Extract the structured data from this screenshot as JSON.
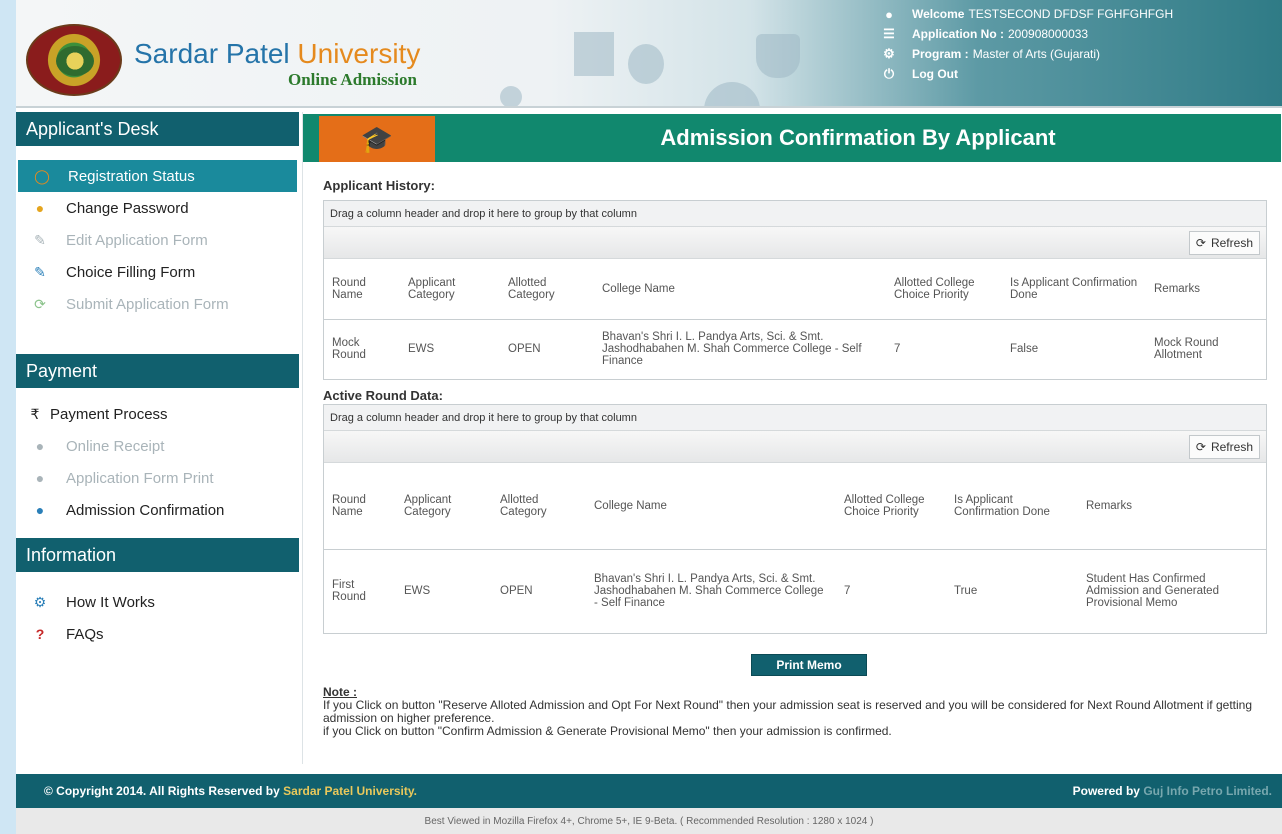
{
  "header": {
    "university_name": "Sardar Patel",
    "university_name_accent": "University",
    "subtitle": "Online Admission",
    "welcome_label": "Welcome",
    "welcome_value": "TESTSECOND DFDSF FGHFGHFGH",
    "application_label": "Application No :",
    "application_value": "200908000033",
    "program_label": "Program :",
    "program_value": "Master of Arts (Gujarati)",
    "logout_label": "Log Out"
  },
  "sidebar": {
    "applicant_desk_title": "Applicant's Desk",
    "applicant_items": [
      {
        "label": "Registration Status",
        "icon": "status-icon",
        "state": "active"
      },
      {
        "label": "Change Password",
        "icon": "key-icon",
        "state": "enabled"
      },
      {
        "label": "Edit Application Form",
        "icon": "edit-icon",
        "state": "disabled"
      },
      {
        "label": "Choice Filling Form",
        "icon": "edit-icon",
        "state": "enabled"
      },
      {
        "label": "Submit Application Form",
        "icon": "submit-icon",
        "state": "disabled"
      }
    ],
    "payment_title": "Payment",
    "payment_items": [
      {
        "label": "Payment Process",
        "icon": "rupee-icon",
        "state": "enabled"
      },
      {
        "label": "Online Receipt",
        "icon": "globe-icon",
        "state": "disabled"
      },
      {
        "label": "Application Form Print",
        "icon": "globe-icon",
        "state": "disabled"
      },
      {
        "label": "Admission Confirmation",
        "icon": "globe-icon",
        "state": "enabled"
      }
    ],
    "information_title": "Information",
    "information_items": [
      {
        "label": "How It Works",
        "icon": "gears-icon"
      },
      {
        "label": "FAQs",
        "icon": "question-icon"
      }
    ]
  },
  "main": {
    "title": "Admission Confirmation By Applicant",
    "applicant_history_label": "Applicant History:",
    "active_round_label": "Active Round Data:",
    "group_panel_text": "Drag a column header and drop it here to group by that column",
    "refresh_label": "Refresh",
    "columns": [
      "Round Name",
      "Applicant Category",
      "Allotted Category",
      "College Name",
      "Allotted College Choice Priority",
      "Is Applicant Confirmation Done",
      "Remarks"
    ],
    "history_rows": [
      {
        "round_name": "Mock Round",
        "applicant_category": "EWS",
        "allotted_category": "OPEN",
        "college_name": "Bhavan's Shri I. L. Pandya Arts, Sci. & Smt. Jashodhabahen M. Shah Commerce College - Self Finance",
        "choice_priority": "7",
        "confirmation_done": "False",
        "remarks": "Mock Round Allotment"
      }
    ],
    "active_rows": [
      {
        "round_name": "First Round",
        "applicant_category": "EWS",
        "allotted_category": "OPEN",
        "college_name": "Bhavan's Shri I. L. Pandya Arts, Sci. & Smt. Jashodhabahen M. Shah Commerce College - Self Finance",
        "choice_priority": "7",
        "confirmation_done": "True",
        "remarks": "Student Has Confirmed Admission and Generated Provisional Memo"
      }
    ],
    "print_memo_label": "Print Memo",
    "note_title": "Note :",
    "note_line1": "If you Click on button \"Reserve Alloted Admission and Opt For Next Round\" then your admission seat is reserved and you will be considered for Next Round Allotment if getting admission on higher preference.",
    "note_line2": "if you Click on button \"Confirm Admission & Generate Provisional Memo\" then your admission is confirmed."
  },
  "footer": {
    "copyright_prefix": "© Copyright 2014. All Rights Reserved by",
    "copyright_org": "Sardar Patel University.",
    "powered_label": "Powered by",
    "powered_org": "Guj Info Petro Limited.",
    "browser_note": "Best Viewed in Mozilla Firefox 4+, Chrome 5+, IE 9-Beta. ( Recommended Resolution : 1280 x 1024 )"
  },
  "colors": {
    "primary": "#11606e",
    "title_bar": "#11886e",
    "accent_orange": "#e46e18",
    "active_item": "#1a8a9c"
  }
}
